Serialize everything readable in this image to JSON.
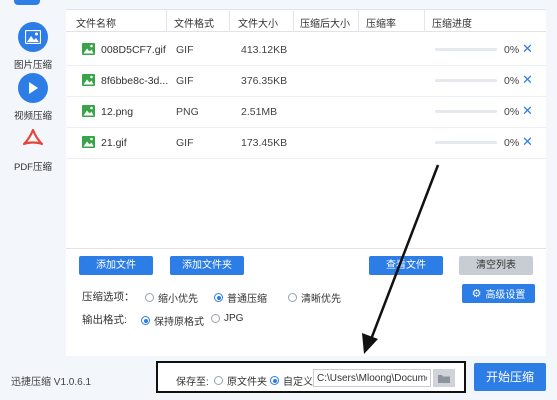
{
  "sidebar": {
    "items": [
      {
        "label": "图片压缩",
        "icon": "image-icon",
        "active": true
      },
      {
        "label": "视频压缩",
        "icon": "play-icon",
        "active": false
      },
      {
        "label": "PDF压缩",
        "icon": "pdf-icon",
        "active": false
      }
    ]
  },
  "table": {
    "headers": [
      "文件名称",
      "文件格式",
      "文件大小",
      "压缩后大小",
      "压缩率",
      "压缩进度"
    ],
    "rows": [
      {
        "name": "008D5CF7.gif",
        "format": "GIF",
        "size": "413.12KB",
        "compressed_size": "",
        "ratio": "",
        "progress": "0%",
        "progress_value": 0
      },
      {
        "name": "8f6bbe8c-3d...",
        "format": "GIF",
        "size": "376.35KB",
        "compressed_size": "",
        "ratio": "",
        "progress": "0%",
        "progress_value": 0
      },
      {
        "name": "12.png",
        "format": "PNG",
        "size": "2.51MB",
        "compressed_size": "",
        "ratio": "",
        "progress": "0%",
        "progress_value": 0
      },
      {
        "name": "21.gif",
        "format": "GIF",
        "size": "173.45KB",
        "compressed_size": "",
        "ratio": "",
        "progress": "0%",
        "progress_value": 0
      }
    ],
    "delete_glyph": "✕"
  },
  "actions": {
    "add_file": "添加文件",
    "add_folder": "添加文件夹",
    "view_file": "查看文件",
    "clear_list": "清空列表"
  },
  "options": {
    "compress_label": "压缩选项：",
    "compress_choices": [
      {
        "label": "缩小优先",
        "selected": false
      },
      {
        "label": "普通压缩",
        "selected": true
      },
      {
        "label": "清晰优先",
        "selected": false
      }
    ],
    "format_label": "输出格式:",
    "format_choices": [
      {
        "label": "保持原格式",
        "selected": true
      },
      {
        "label": "JPG",
        "selected": false
      }
    ],
    "advanced": "高级设置"
  },
  "footer": {
    "version": "迅捷压缩 V1.0.6.1",
    "save_to": "保存至:",
    "save_choices": [
      {
        "label": "原文件夹",
        "selected": false
      },
      {
        "label": "自定义",
        "selected": true
      }
    ],
    "path_value": "C:\\Users\\Mloong\\Docume",
    "start": "开始压缩"
  },
  "colors": {
    "accent": "#2d7de6",
    "image_icon_green": "#3aa34a",
    "pdf_red": "#e2473d"
  }
}
